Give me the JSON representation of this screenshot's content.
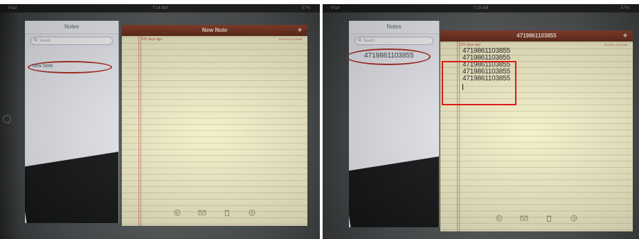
{
  "caption": "",
  "left_shot": {
    "statusbar": {
      "carrier": "iPad",
      "time": "7:14 AM",
      "battery": "57%"
    },
    "sidebar": {
      "title": "Notes",
      "search_placeholder": "Search",
      "items": [
        {
          "label": "New Note"
        }
      ]
    },
    "notepad": {
      "title": "New Note",
      "add_label": "+",
      "date_text": "126 days ago",
      "date_right": "8/7/2011  11:16 AM",
      "lines": []
    },
    "toolbar": [
      "back-icon",
      "mail-icon",
      "trash-icon",
      "forward-icon"
    ]
  },
  "right_shot": {
    "statusbar": {
      "carrier": "iPad",
      "time": "7:15 AM",
      "battery": "57%"
    },
    "sidebar": {
      "title": "Notes",
      "search_placeholder": "Search",
      "items": [
        {
          "label": "4719861103855"
        }
      ]
    },
    "notepad": {
      "title": "4719861103855",
      "add_label": "+",
      "date_text": "126 days ago",
      "date_right": "8/7/2011  11:16 AM",
      "lines": [
        "4719861103855",
        "4719861103855",
        "4719861103855",
        "4719861103855",
        "4719861103855"
      ]
    },
    "toolbar": [
      "back-icon",
      "mail-icon",
      "trash-icon",
      "forward-icon"
    ]
  },
  "colors": {
    "annotation_red": "#e01616",
    "header_brown": "#6e2b17",
    "paper_yellow": "#f3efc8"
  }
}
